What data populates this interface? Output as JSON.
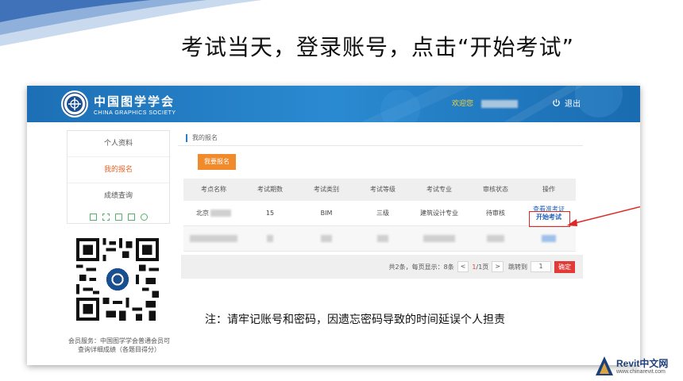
{
  "slide": {
    "title": "考试当天，登录账号，点击“开始考试”",
    "notice": "注：请牢记账号和密码，因遗忘密码导致的时间延误个人担责"
  },
  "header": {
    "logo_cn": "中国图学学会",
    "logo_en": "CHINA GRAPHICS SOCIETY",
    "welcome": "欢迎您",
    "logout": "退出"
  },
  "sidebar": {
    "items": [
      {
        "label": "个人资料",
        "active": false
      },
      {
        "label": "我的报名",
        "active": true
      },
      {
        "label": "成绩查询",
        "active": false
      }
    ]
  },
  "member_note": "会员服务：中国图学学会普通会员可查询详细成绩（各题目得分）",
  "main": {
    "breadcrumb": "我的报名",
    "apply_button": "我要报名",
    "table": {
      "headers": [
        "考点名称",
        "考试期数",
        "考试类别",
        "考试等级",
        "考试专业",
        "审核状态",
        "操作"
      ],
      "row1": {
        "site": "北京",
        "period": "15",
        "category": "BIM",
        "level": "三级",
        "major": "建筑设计专业",
        "status": "待审核",
        "op_view": "查看准考证",
        "op_start": "开始考试"
      }
    },
    "pager": {
      "summary": "共2条，每页显示：8条",
      "prev": "<",
      "current": "1",
      "total": "/1页",
      "next": ">",
      "jump": "跳转到",
      "page_input": "1",
      "confirm": "确定"
    }
  },
  "watermark": {
    "name": "Revit中文网",
    "url": "www.chinarevit.com"
  },
  "colors": {
    "header_blue": "#1d6fb5",
    "welcome_yellow": "#f5d23c",
    "active_orange": "#e6662a",
    "apply_orange": "#f08a2b",
    "link_blue": "#2160b8",
    "highlight_red": "#e02525",
    "confirm_red": "#e23a37"
  }
}
